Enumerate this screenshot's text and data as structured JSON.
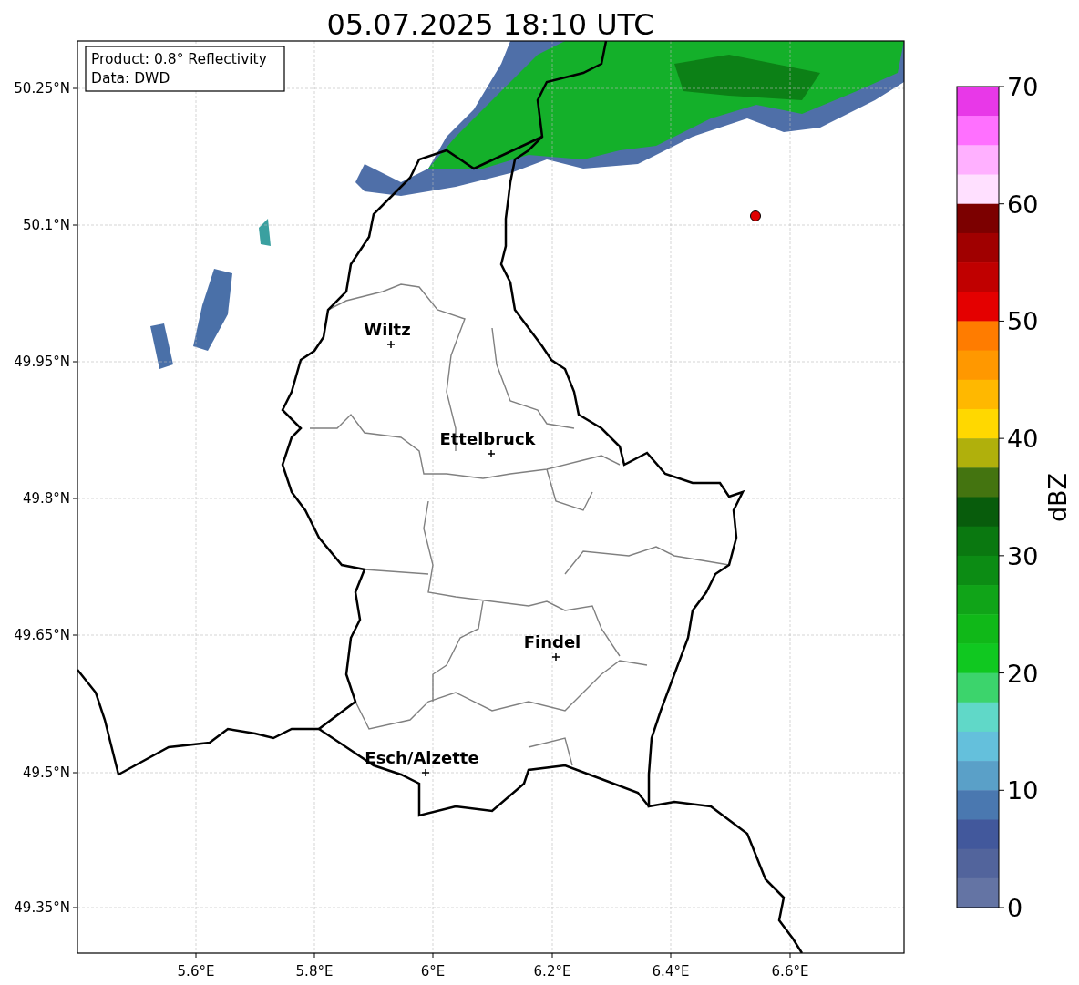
{
  "title": "05.07.2025 18:10 UTC",
  "info_box": {
    "lines": [
      "Product: 0.8° Reflectivity",
      "Data: DWD"
    ]
  },
  "y_ticks": [
    "50.25°N",
    "50.1°N",
    "49.95°N",
    "49.8°N",
    "49.65°N",
    "49.5°N",
    "49.35°N"
  ],
  "x_ticks": [
    "5.6°E",
    "5.8°E",
    "6°E",
    "6.2°E",
    "6.4°E",
    "6.6°E"
  ],
  "cities": [
    {
      "name": "Wiltz"
    },
    {
      "name": "Ettelbruck"
    },
    {
      "name": "Findel"
    },
    {
      "name": "Esch/Alzette"
    }
  ],
  "colorbar": {
    "label": "dBZ",
    "ticks": [
      "70",
      "60",
      "50",
      "40",
      "30",
      "20",
      "10",
      "0"
    ],
    "bins": [
      {
        "color": "#e838e8"
      },
      {
        "color": "#ff70ff"
      },
      {
        "color": "#ffb0ff"
      },
      {
        "color": "#ffe0ff"
      },
      {
        "color": "#7c0000"
      },
      {
        "color": "#a00000"
      },
      {
        "color": "#c00000"
      },
      {
        "color": "#e40000"
      },
      {
        "color": "#ff7c00"
      },
      {
        "color": "#ff9800"
      },
      {
        "color": "#ffb800"
      },
      {
        "color": "#ffd800"
      },
      {
        "color": "#b0b00c"
      },
      {
        "color": "#447410"
      },
      {
        "color": "#085c0c"
      },
      {
        "color": "#0a7810"
      },
      {
        "color": "#0c8c14"
      },
      {
        "color": "#10a418"
      },
      {
        "color": "#10b818"
      },
      {
        "color": "#10c820"
      },
      {
        "color": "#3cd46c"
      },
      {
        "color": "#60d8c8"
      },
      {
        "color": "#64c0dc"
      },
      {
        "color": "#5aa0c8"
      },
      {
        "color": "#4a78b0"
      },
      {
        "color": "#42589c"
      },
      {
        "color": "#52649c"
      },
      {
        "color": "#6474a4"
      }
    ]
  }
}
